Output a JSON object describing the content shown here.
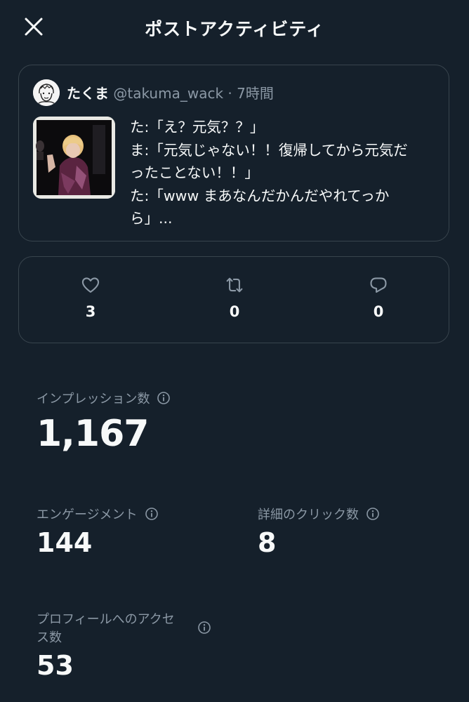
{
  "header": {
    "title": "ポストアクティビティ"
  },
  "post": {
    "author_name": "たくま",
    "author_handle": "@takuma_wack",
    "separator": "·",
    "time": "7時間",
    "text_lines": [
      "た:「え？元気？？」",
      "ま:「元気じゃない！！復帰してから元気だ",
      "ったことない！！」",
      "た:「www まあなんだかんだやれてっか",
      "ら」..."
    ]
  },
  "engagement": {
    "likes": "3",
    "reposts": "0",
    "replies": "0"
  },
  "metrics": {
    "impressions_label": "インプレッション数",
    "impressions_value": "1,167",
    "engagements_label": "エンゲージメント",
    "engagements_value": "144",
    "detail_clicks_label": "詳細のクリック数",
    "detail_clicks_value": "8",
    "profile_visits_label_line1": "プロフィールへのアクセ",
    "profile_visits_label_line2": "ス数",
    "profile_visits_value": "53"
  },
  "colors": {
    "background": "#15202b",
    "border": "#38444d",
    "secondary_text": "#8b98a5",
    "primary_text": "#f7f9f9"
  },
  "icons": [
    "close-icon",
    "heart-icon",
    "repost-icon",
    "reply-icon",
    "info-icon"
  ]
}
